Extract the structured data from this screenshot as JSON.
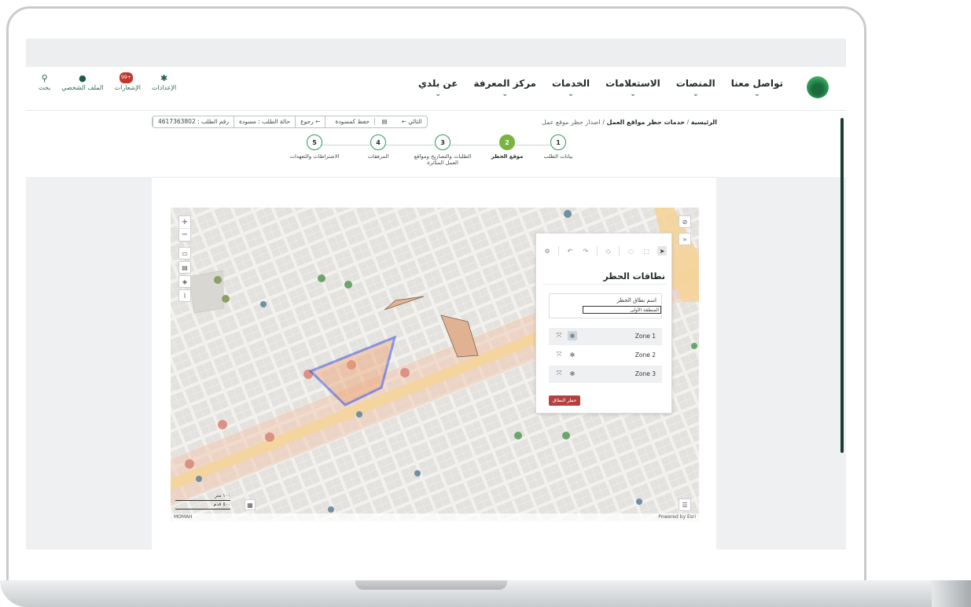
{
  "header": {
    "nav": [
      {
        "label": "عن بلدي"
      },
      {
        "label": "مركز المعرفة"
      },
      {
        "label": "الخدمات"
      },
      {
        "label": "الاستعلامات"
      },
      {
        "label": "المنصات"
      },
      {
        "label": "تواصل معنا"
      }
    ],
    "tools": [
      {
        "label": "بحث",
        "icon": "search-icon"
      },
      {
        "label": "الملف الشخصي",
        "icon": "user-icon"
      },
      {
        "label": "الإشعارات",
        "icon": "bell-icon",
        "badge": "+99"
      },
      {
        "label": "الإعدادات",
        "icon": "gear-icon"
      }
    ]
  },
  "breadcrumb": {
    "home": "الرئيسية",
    "section": "خدمات حظر مواقع العمل",
    "current": "اصدار حظر موقع عمل",
    "sep": "/"
  },
  "actionbar": {
    "request_no": "رقم الطلب : 4617363802",
    "status": "حالة الطلب : مسودة",
    "back": "← رجوع",
    "save": "حفظ كمسودة",
    "next": "التالي ←"
  },
  "steps": [
    {
      "num": "1",
      "label": "بيانات الطلب"
    },
    {
      "num": "2",
      "label": "موقع الحظر",
      "active": true
    },
    {
      "num": "3",
      "label": "الطلبات والتصاريح ومواقع العمل المتأثرة"
    },
    {
      "num": "4",
      "label": "المرفقات"
    },
    {
      "num": "5",
      "label": "الاشتراطات والتعهدات"
    }
  ],
  "map": {
    "scale_top": "١٠٠ متر",
    "scale_bottom": "٥٠٠ قدم",
    "attribution_left": "MOMAH",
    "attribution_right": "Powered by Esri"
  },
  "panel": {
    "title": "نطاقات الحظر",
    "name_label": "اسم نطاق الحظر",
    "name_value": "المنطقة الأولى",
    "zones": [
      {
        "label": "Zone 1",
        "active": true
      },
      {
        "label": "Zone 2",
        "active": false
      },
      {
        "label": "Zone 3",
        "active": false
      }
    ],
    "delete_label": "حظر النطاق"
  },
  "colors": {
    "brand_green": "#1b5b43",
    "step_active": "#7ab43f",
    "zone_blue": "#1430e0",
    "zone_fill": "#e0b090",
    "danger": "#b5403f"
  }
}
